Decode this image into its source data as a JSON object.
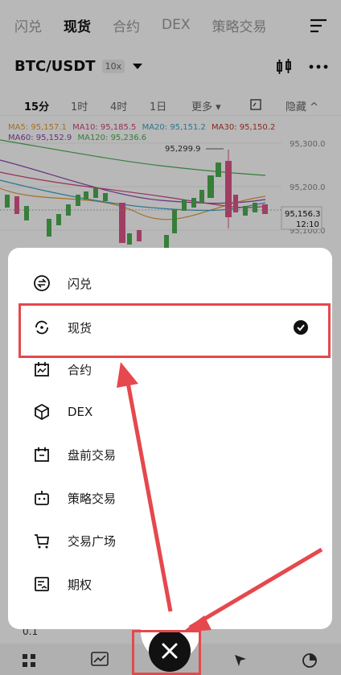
{
  "topnav": {
    "tabs": [
      {
        "label": "闪兑",
        "active": false
      },
      {
        "label": "现货",
        "active": true
      },
      {
        "label": "合约",
        "active": false
      },
      {
        "label": "DEX",
        "active": false
      },
      {
        "label": "策略交易",
        "active": false
      }
    ]
  },
  "pair": {
    "symbol": "BTC/USDT",
    "leverage": "10x"
  },
  "timeframes": {
    "items": [
      "15分",
      "1时",
      "4时",
      "1日"
    ],
    "more": "更多",
    "hide": "隐藏"
  },
  "ma": {
    "row1": [
      {
        "label": "MA5: 95,157.1",
        "color": "#e39a36"
      },
      {
        "label": "MA10: 95,185.5",
        "color": "#d0457f"
      },
      {
        "label": "MA20: 95,151.2",
        "color": "#3aa4c6"
      },
      {
        "label": "MA30: 95,150.2",
        "color": "#c0392b"
      }
    ],
    "row2": [
      {
        "label": "MA60: 95,152.9",
        "color": "#8e44ad"
      },
      {
        "label": "MA120: 95,236.6",
        "color": "#4caf50"
      }
    ]
  },
  "chart_data": {
    "type": "candlestick",
    "y_ticks": [
      "95,300.0",
      "95,200.0",
      "95,100.0"
    ],
    "high_label": "95,299.9",
    "last_price": "95,156.3",
    "countdown": "12:10",
    "colors": {
      "up": "#4caf50",
      "down": "#e0558a"
    }
  },
  "popup": {
    "items": [
      {
        "label": "闪兑",
        "icon": "swap-icon",
        "selected": false
      },
      {
        "label": "现货",
        "icon": "spot-icon",
        "selected": true
      },
      {
        "label": "合约",
        "icon": "futures-icon",
        "selected": false
      },
      {
        "label": "DEX",
        "icon": "cube-icon",
        "selected": false
      },
      {
        "label": "盘前交易",
        "icon": "premarket-icon",
        "selected": false
      },
      {
        "label": "策略交易",
        "icon": "bot-icon",
        "selected": false
      },
      {
        "label": "交易广场",
        "icon": "cart-icon",
        "selected": false
      },
      {
        "label": "期权",
        "icon": "options-icon",
        "selected": false
      }
    ]
  },
  "bottom": {
    "strip_value": "0.1"
  },
  "accent_red": "#e5484d"
}
